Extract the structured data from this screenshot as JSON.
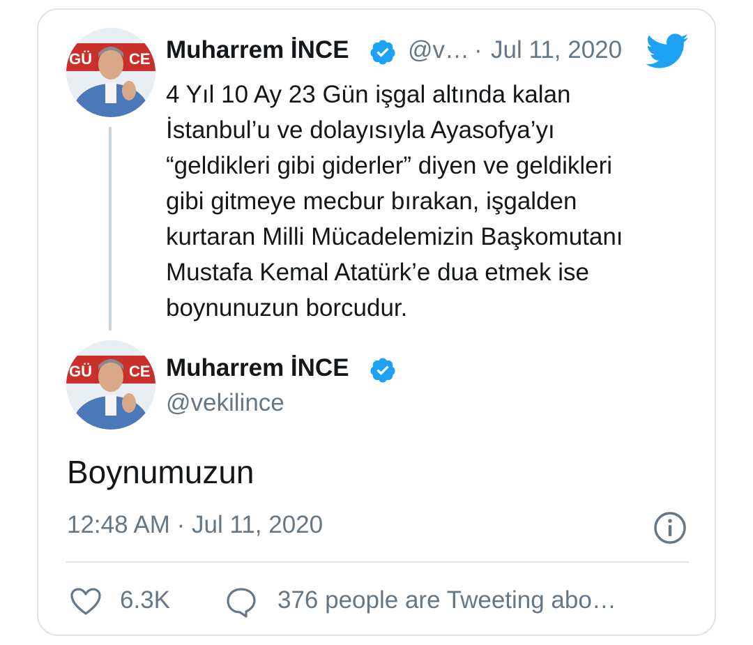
{
  "quoted_tweet": {
    "author_name": "Muharrem İNCE",
    "handle_truncated": "@v…",
    "separator": "·",
    "date": "Jul 11, 2020",
    "text": "4 Yıl 10 Ay 23 Gün işgal altında kalan\nİstanbul’u ve dolayısıyla Ayasofya’yı\n“geldikleri gibi giderler” diyen ve geldikleri\ngibi gitmeye mecbur bırakan, işgalden\nkurtaran Milli Mücadelemizin Başkomutanı\nMustafa Kemal Atatürk’e dua etmek ise\nboynunuzun borcudur."
  },
  "reply_tweet": {
    "author_name": "Muharrem İNCE",
    "handle": "@vekilince",
    "text": "Boynumuzun",
    "timestamp": "12:48 AM · Jul 11, 2020"
  },
  "actions": {
    "like_count": "6.3K",
    "tweeting_text": "376 people are Tweeting abo…"
  },
  "icons": {
    "verified": "verified-badge-icon",
    "brand": "twitter-bird-icon",
    "info": "info-icon",
    "like": "heart-icon",
    "reply": "speech-bubble-icon"
  },
  "colors": {
    "twitter_blue": "#1da1f2",
    "text_primary": "#14171a",
    "text_muted": "#657786",
    "border": "#dde3e8"
  }
}
